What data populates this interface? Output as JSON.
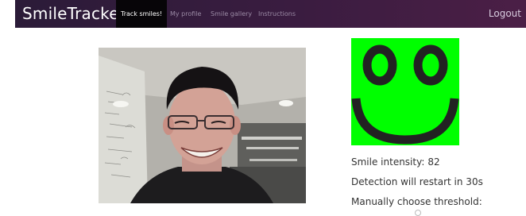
{
  "navbar": {
    "brand": "SmileTracker",
    "items": [
      {
        "label": "Track smiles!",
        "active": true
      },
      {
        "label": "My profile",
        "active": false
      },
      {
        "label": "Smile gallery",
        "active": false
      },
      {
        "label": "Instructions",
        "active": false
      }
    ],
    "logout": "Logout"
  },
  "smiley": {
    "icon": "smiley-face-icon",
    "background": "#00ff00",
    "stroke": "#222222"
  },
  "status": {
    "intensity_label": "Smile intensity:",
    "intensity_value": "82",
    "restart_text": "Detection will restart in 30s",
    "manual_text": "Manually choose threshold:"
  }
}
